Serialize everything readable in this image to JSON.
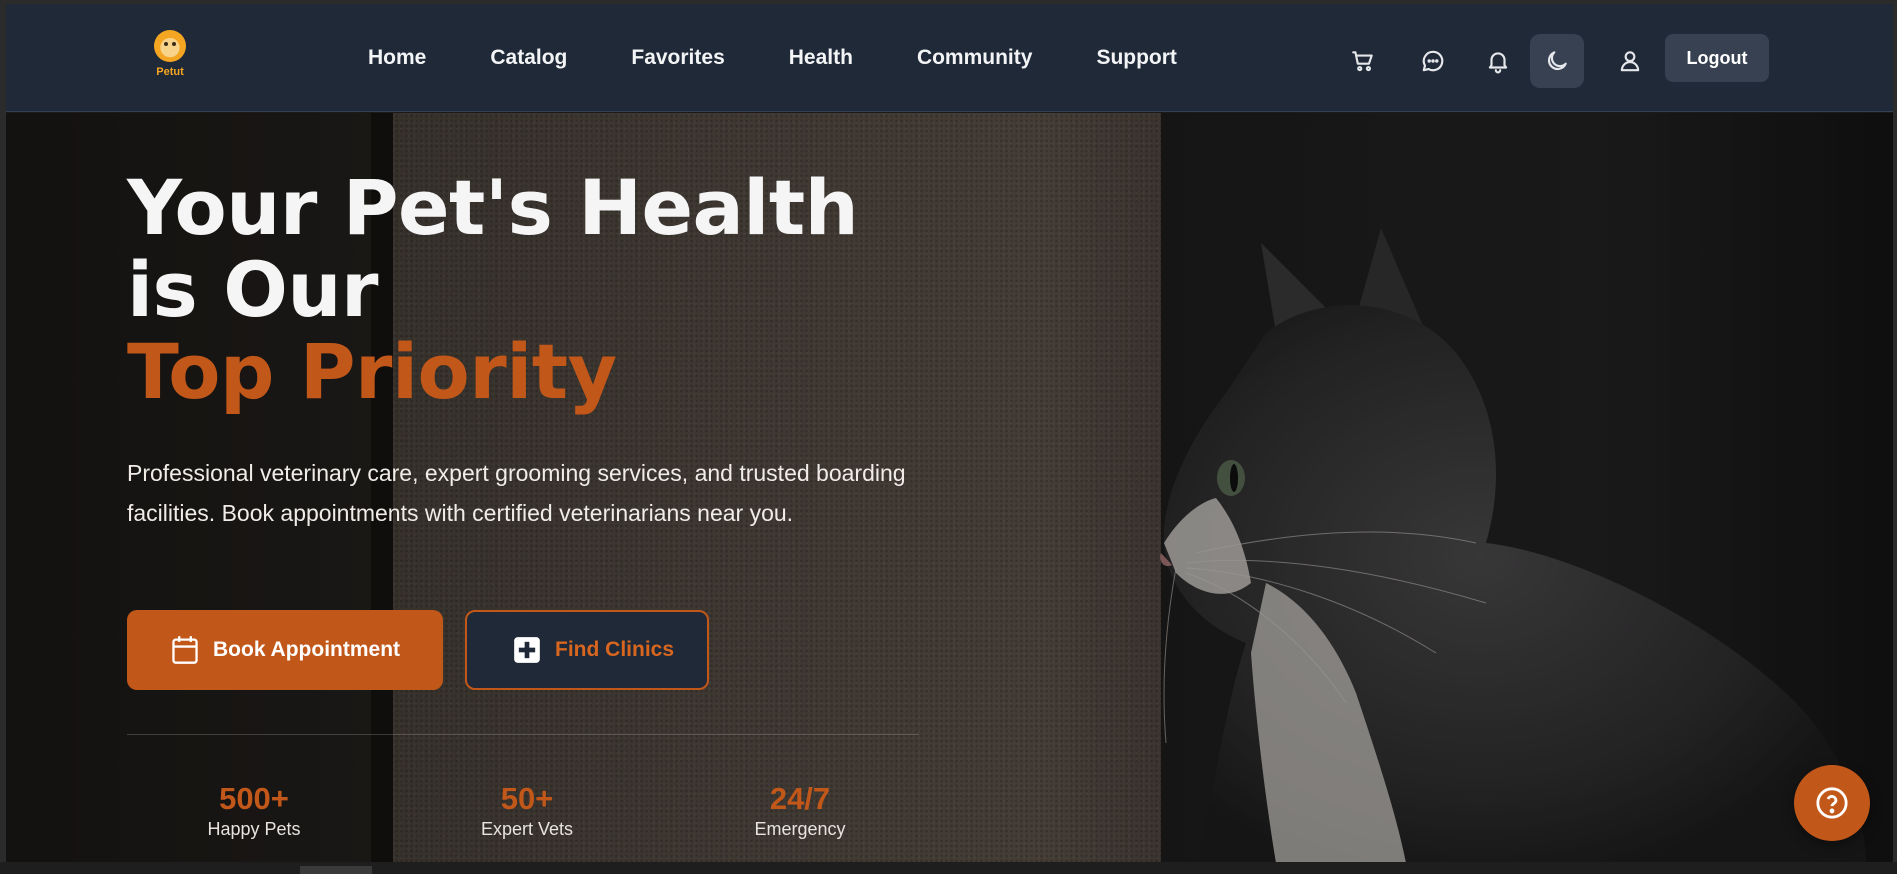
{
  "brand": {
    "name": "Petut"
  },
  "nav": {
    "items": [
      {
        "label": "Home"
      },
      {
        "label": "Catalog"
      },
      {
        "label": "Favorites"
      },
      {
        "label": "Health"
      },
      {
        "label": "Community"
      },
      {
        "label": "Support"
      }
    ],
    "icons": [
      "cart-icon",
      "chat-icon",
      "bell-icon",
      "moon-icon",
      "user-icon"
    ],
    "logout_label": "Logout"
  },
  "hero": {
    "title_line1": "Your Pet's Health is Our",
    "title_accent": "Top Priority",
    "description": "Professional veterinary care, expert grooming services, and trusted boarding facilities. Book appointments with certified veterinarians near you.",
    "book_label": "Book Appointment",
    "find_label": "Find Clinics",
    "stats": [
      {
        "value": "500+",
        "label": "Happy Pets"
      },
      {
        "value": "50+",
        "label": "Expert Vets"
      },
      {
        "value": "24/7",
        "label": "Emergency"
      }
    ]
  },
  "colors": {
    "accent": "#c2571a",
    "nav_bg": "#1f2937",
    "button_dark": "#374151"
  },
  "help_icon": "question-circle-icon"
}
